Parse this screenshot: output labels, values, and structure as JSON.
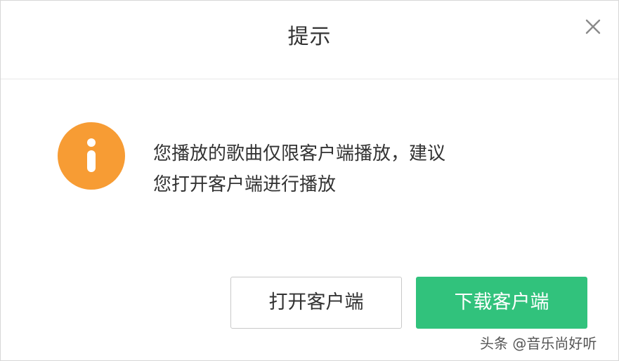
{
  "dialog": {
    "title": "提示",
    "close_icon": "close-icon",
    "info_icon": "info-icon",
    "message_line1": "您播放的歌曲仅限客户端播放，建议",
    "message_line2": "您打开客户端进行播放",
    "open_client_label": "打开客户端",
    "download_client_label": "下载客户端"
  },
  "watermark": "头条 @音乐尚好听",
  "colors": {
    "accent_green": "#31c27c",
    "info_orange": "#f79c34",
    "text": "#333333"
  }
}
